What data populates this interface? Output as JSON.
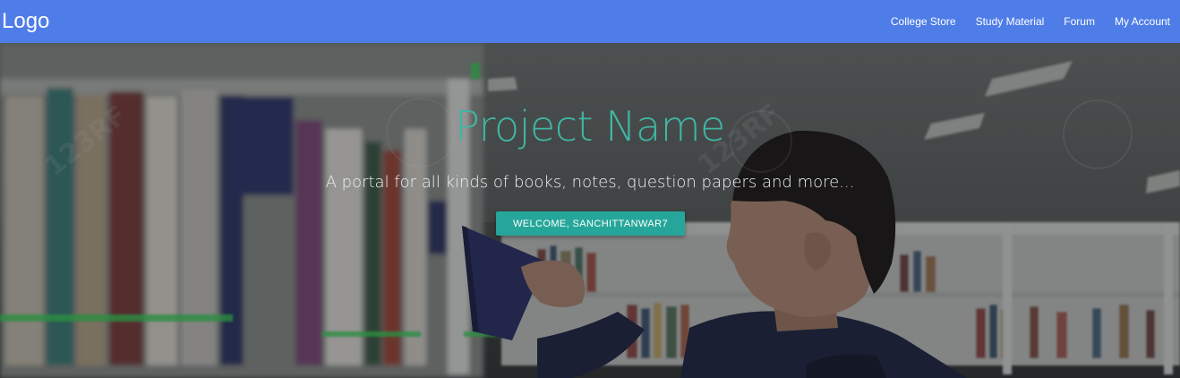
{
  "navbar": {
    "logo": "Logo",
    "links": [
      {
        "label": "College Store"
      },
      {
        "label": "Study Material"
      },
      {
        "label": "Forum"
      },
      {
        "label": "My Account"
      }
    ],
    "background_color": "#4f7de8"
  },
  "hero": {
    "title": "Project Name",
    "subtitle": "A portal for all kinds of books, notes, question papers and more...",
    "welcome_button": "WELCOME, SANCHITTANWAR7",
    "title_color": "#3fb6a3",
    "button_color": "#26a69a",
    "watermark_text": "123RF"
  }
}
